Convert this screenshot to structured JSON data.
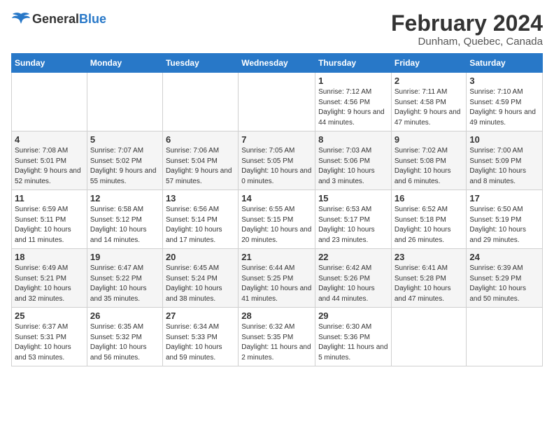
{
  "logo": {
    "general": "General",
    "blue": "Blue"
  },
  "title": {
    "main": "February 2024",
    "sub": "Dunham, Quebec, Canada"
  },
  "weekdays": [
    "Sunday",
    "Monday",
    "Tuesday",
    "Wednesday",
    "Thursday",
    "Friday",
    "Saturday"
  ],
  "weeks": [
    [
      {
        "day": "",
        "sunrise": "",
        "sunset": "",
        "daylight": ""
      },
      {
        "day": "",
        "sunrise": "",
        "sunset": "",
        "daylight": ""
      },
      {
        "day": "",
        "sunrise": "",
        "sunset": "",
        "daylight": ""
      },
      {
        "day": "",
        "sunrise": "",
        "sunset": "",
        "daylight": ""
      },
      {
        "day": "1",
        "sunrise": "7:12 AM",
        "sunset": "4:56 PM",
        "daylight": "9 hours and 44 minutes."
      },
      {
        "day": "2",
        "sunrise": "7:11 AM",
        "sunset": "4:58 PM",
        "daylight": "9 hours and 47 minutes."
      },
      {
        "day": "3",
        "sunrise": "7:10 AM",
        "sunset": "4:59 PM",
        "daylight": "9 hours and 49 minutes."
      }
    ],
    [
      {
        "day": "4",
        "sunrise": "7:08 AM",
        "sunset": "5:01 PM",
        "daylight": "9 hours and 52 minutes."
      },
      {
        "day": "5",
        "sunrise": "7:07 AM",
        "sunset": "5:02 PM",
        "daylight": "9 hours and 55 minutes."
      },
      {
        "day": "6",
        "sunrise": "7:06 AM",
        "sunset": "5:04 PM",
        "daylight": "9 hours and 57 minutes."
      },
      {
        "day": "7",
        "sunrise": "7:05 AM",
        "sunset": "5:05 PM",
        "daylight": "10 hours and 0 minutes."
      },
      {
        "day": "8",
        "sunrise": "7:03 AM",
        "sunset": "5:06 PM",
        "daylight": "10 hours and 3 minutes."
      },
      {
        "day": "9",
        "sunrise": "7:02 AM",
        "sunset": "5:08 PM",
        "daylight": "10 hours and 6 minutes."
      },
      {
        "day": "10",
        "sunrise": "7:00 AM",
        "sunset": "5:09 PM",
        "daylight": "10 hours and 8 minutes."
      }
    ],
    [
      {
        "day": "11",
        "sunrise": "6:59 AM",
        "sunset": "5:11 PM",
        "daylight": "10 hours and 11 minutes."
      },
      {
        "day": "12",
        "sunrise": "6:58 AM",
        "sunset": "5:12 PM",
        "daylight": "10 hours and 14 minutes."
      },
      {
        "day": "13",
        "sunrise": "6:56 AM",
        "sunset": "5:14 PM",
        "daylight": "10 hours and 17 minutes."
      },
      {
        "day": "14",
        "sunrise": "6:55 AM",
        "sunset": "5:15 PM",
        "daylight": "10 hours and 20 minutes."
      },
      {
        "day": "15",
        "sunrise": "6:53 AM",
        "sunset": "5:17 PM",
        "daylight": "10 hours and 23 minutes."
      },
      {
        "day": "16",
        "sunrise": "6:52 AM",
        "sunset": "5:18 PM",
        "daylight": "10 hours and 26 minutes."
      },
      {
        "day": "17",
        "sunrise": "6:50 AM",
        "sunset": "5:19 PM",
        "daylight": "10 hours and 29 minutes."
      }
    ],
    [
      {
        "day": "18",
        "sunrise": "6:49 AM",
        "sunset": "5:21 PM",
        "daylight": "10 hours and 32 minutes."
      },
      {
        "day": "19",
        "sunrise": "6:47 AM",
        "sunset": "5:22 PM",
        "daylight": "10 hours and 35 minutes."
      },
      {
        "day": "20",
        "sunrise": "6:45 AM",
        "sunset": "5:24 PM",
        "daylight": "10 hours and 38 minutes."
      },
      {
        "day": "21",
        "sunrise": "6:44 AM",
        "sunset": "5:25 PM",
        "daylight": "10 hours and 41 minutes."
      },
      {
        "day": "22",
        "sunrise": "6:42 AM",
        "sunset": "5:26 PM",
        "daylight": "10 hours and 44 minutes."
      },
      {
        "day": "23",
        "sunrise": "6:41 AM",
        "sunset": "5:28 PM",
        "daylight": "10 hours and 47 minutes."
      },
      {
        "day": "24",
        "sunrise": "6:39 AM",
        "sunset": "5:29 PM",
        "daylight": "10 hours and 50 minutes."
      }
    ],
    [
      {
        "day": "25",
        "sunrise": "6:37 AM",
        "sunset": "5:31 PM",
        "daylight": "10 hours and 53 minutes."
      },
      {
        "day": "26",
        "sunrise": "6:35 AM",
        "sunset": "5:32 PM",
        "daylight": "10 hours and 56 minutes."
      },
      {
        "day": "27",
        "sunrise": "6:34 AM",
        "sunset": "5:33 PM",
        "daylight": "10 hours and 59 minutes."
      },
      {
        "day": "28",
        "sunrise": "6:32 AM",
        "sunset": "5:35 PM",
        "daylight": "11 hours and 2 minutes."
      },
      {
        "day": "29",
        "sunrise": "6:30 AM",
        "sunset": "5:36 PM",
        "daylight": "11 hours and 5 minutes."
      },
      {
        "day": "",
        "sunrise": "",
        "sunset": "",
        "daylight": ""
      },
      {
        "day": "",
        "sunrise": "",
        "sunset": "",
        "daylight": ""
      }
    ]
  ],
  "labels": {
    "sunrise_prefix": "Sunrise: ",
    "sunset_prefix": "Sunset: ",
    "daylight_prefix": "Daylight: "
  }
}
